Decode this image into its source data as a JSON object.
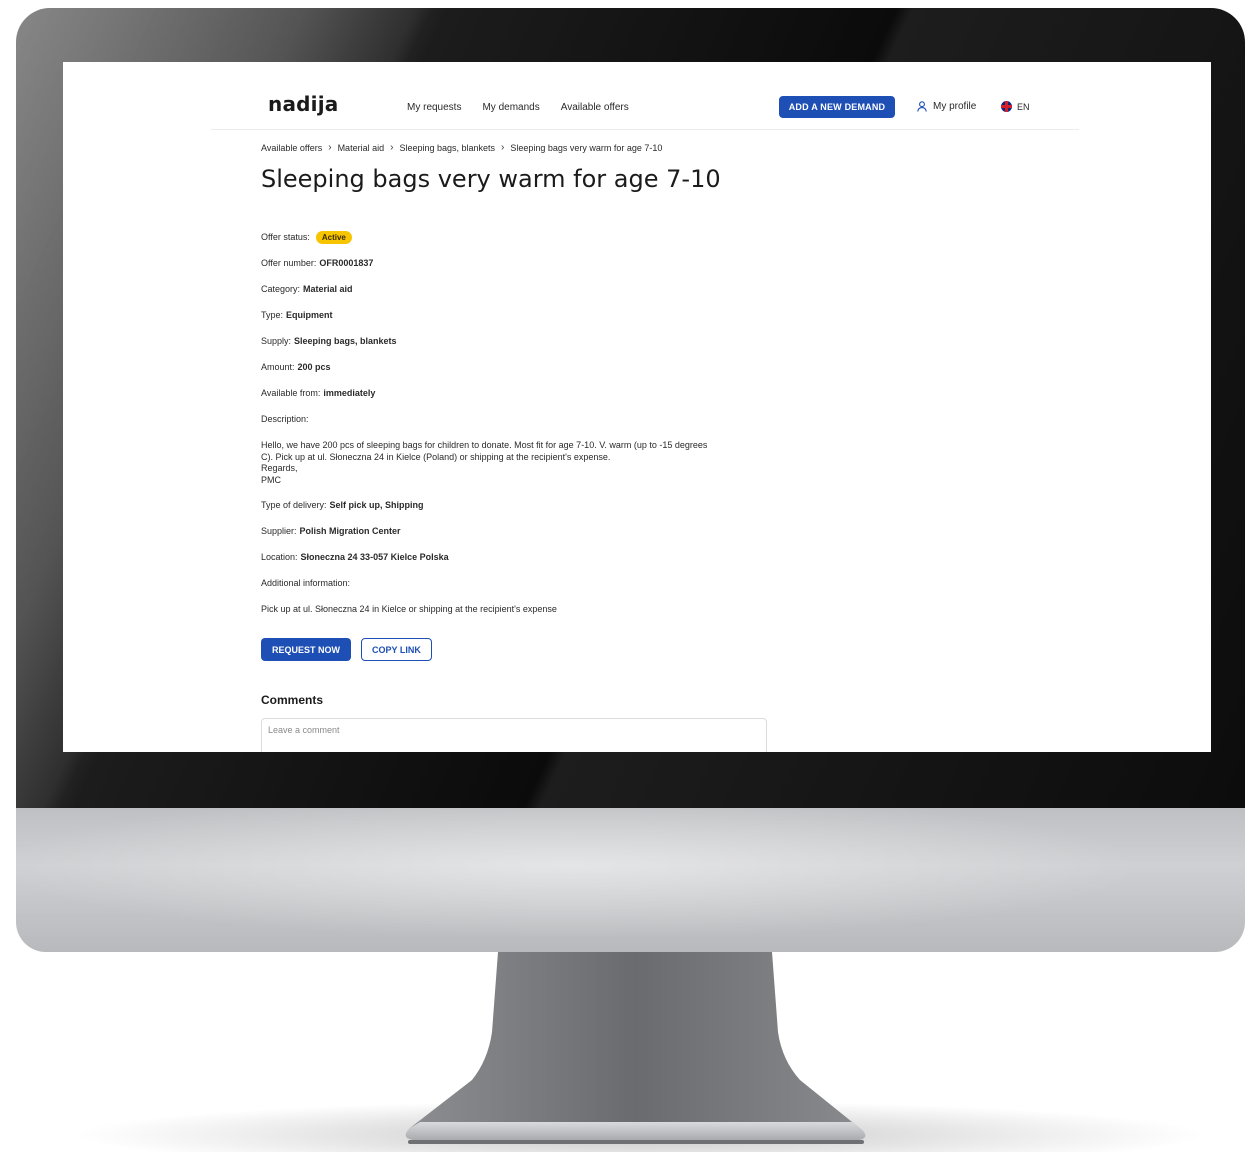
{
  "header": {
    "logo": "nadija",
    "nav": [
      "My requests",
      "My demands",
      "Available offers"
    ],
    "add_demand": "ADD A NEW DEMAND",
    "profile": "My profile",
    "language": "EN"
  },
  "breadcrumb": [
    "Available offers",
    "Material aid",
    "Sleeping bags, blankets",
    "Sleeping bags very warm for age 7-10"
  ],
  "title": "Sleeping bags very warm for age 7-10",
  "offer": {
    "status_label": "Offer status:",
    "status_value": "Active",
    "number_label": "Offer number:",
    "number_value": "OFR0001837",
    "category_label": "Category:",
    "category_value": "Material aid",
    "type_label": "Type:",
    "type_value": "Equipment",
    "supply_label": "Supply:",
    "supply_value": "Sleeping bags, blankets",
    "amount_label": "Amount:",
    "amount_value": "200 pcs",
    "available_label": "Available from:",
    "available_value": "immediately",
    "description_label": "Description:",
    "description_lines": [
      "Hello, we have 200 pcs of sleeping bags for children to donate. Most fit for age 7-10. V. warm (up to -15 degrees",
      "C). Pick up at ul. Słoneczna 24 in Kielce (Poland) or shipping at the recipient's expense.",
      "Regards,",
      "PMC"
    ],
    "delivery_label": "Type of delivery:",
    "delivery_value": "Self pick up, Shipping",
    "supplier_label": "Supplier:",
    "supplier_value": "Polish Migration Center",
    "location_label": "Location:",
    "location_value": "Słoneczna 24 33-057 Kielce Polska",
    "additional_label": "Additional information:",
    "additional_value": "Pick up at ul. Słoneczna 24 in Kielce or shipping at the recipient's expense"
  },
  "actions": {
    "request": "REQUEST NOW",
    "copy": "COPY LINK"
  },
  "comments": {
    "title": "Comments",
    "placeholder": "Leave a comment"
  },
  "colors": {
    "primary": "#1e4fb5",
    "badge": "#f7c400"
  },
  "icons": {
    "profile": "user-icon",
    "language": "uk-flag-icon",
    "breadcrumb_separator": "chevron-right-icon"
  }
}
